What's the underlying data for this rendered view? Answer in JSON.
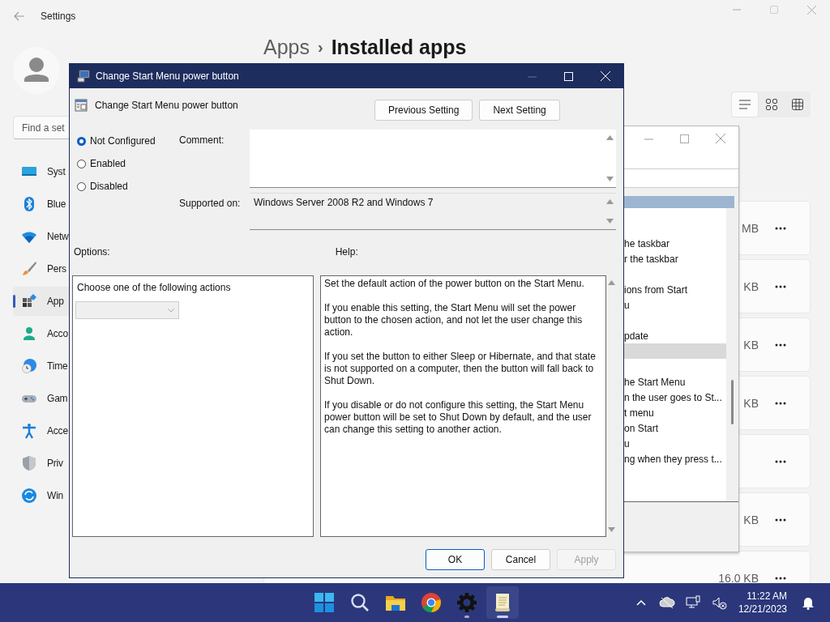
{
  "settings_window": {
    "title": "Settings",
    "search": {
      "placeholder": "Find a set"
    },
    "heading": {
      "parent": "Apps",
      "separator": "›",
      "current": "Installed apps"
    },
    "sidebar": {
      "items": [
        {
          "label": "Syst",
          "kind": "system",
          "selected": false
        },
        {
          "label": "Blue",
          "kind": "bluetooth",
          "selected": false
        },
        {
          "label": "Netw",
          "kind": "network",
          "selected": false
        },
        {
          "label": "Pers",
          "kind": "personalization",
          "selected": false
        },
        {
          "label": "App",
          "kind": "apps",
          "selected": true
        },
        {
          "label": "Acco",
          "kind": "accounts",
          "selected": false
        },
        {
          "label": "Time",
          "kind": "time",
          "selected": false
        },
        {
          "label": "Gam",
          "kind": "gaming",
          "selected": false
        },
        {
          "label": "Acce",
          "kind": "accessibility",
          "selected": false
        },
        {
          "label": "Priv",
          "kind": "privacy",
          "selected": false
        },
        {
          "label": "Win",
          "kind": "update",
          "selected": false
        }
      ]
    },
    "view_buttons": [
      {
        "kind": "list",
        "selected": true
      },
      {
        "kind": "tiles",
        "selected": false
      },
      {
        "kind": "grid",
        "selected": false
      }
    ],
    "app_rows": [
      {
        "size": "MB"
      },
      {
        "size": "KB"
      },
      {
        "size": "KB"
      },
      {
        "size": "KB"
      },
      {},
      {
        "size": "KB"
      },
      {
        "size": "16.0 KB"
      }
    ]
  },
  "policy_editor_window": {
    "rows": [
      {
        "text": "he taskbar",
        "selected": false
      },
      {
        "text": "r the taskbar",
        "selected": false
      },
      {
        "selected": false
      },
      {
        "text": "ions from Start",
        "selected": false
      },
      {
        "text": "u",
        "selected": false
      },
      {
        "selected": false
      },
      {
        "text": "pdate",
        "selected": false
      },
      {
        "selected": true
      },
      {
        "selected": false
      },
      {
        "text": "he Start Menu",
        "selected": false
      },
      {
        "text": "n the user goes to St...",
        "selected": false
      },
      {
        "text": "t menu",
        "selected": false
      },
      {
        "text": "on Start",
        "selected": false
      },
      {
        "text": "u",
        "selected": false
      },
      {
        "text": "ng when they press t...",
        "selected": false
      }
    ]
  },
  "dialog": {
    "title": "Change Start Menu power button",
    "setting_name": "Change Start Menu power button",
    "nav_buttons": [
      "Previous Setting",
      "Next Setting"
    ],
    "states": [
      {
        "label": "Not Configured",
        "selected": true
      },
      {
        "label": "Enabled",
        "selected": false
      },
      {
        "label": "Disabled",
        "selected": false
      }
    ],
    "comment_label": "Comment:",
    "supported_label": "Supported on:",
    "supported_value": "Windows Server 2008 R2 and Windows 7",
    "options_label": "Options:",
    "help_label": "Help:",
    "options": {
      "prompt": "Choose one of the following actions",
      "dropdown": {
        "disabled": true
      }
    },
    "help_paragraphs": [
      "Set the default action of the power button on the Start Menu.",
      "If you enable this setting, the Start Menu will set the power button to the chosen action, and not let the user change this action.",
      "If you set the button to either Sleep or Hibernate, and that state is not supported on a computer, then the button will fall back to Shut Down.",
      "If you disable or do not configure this setting, the Start Menu power button will be set to Shut Down by default, and the user can change this setting to another action."
    ],
    "buttons": [
      {
        "label": "OK",
        "kind": "default",
        "disabled": false
      },
      {
        "label": "Cancel",
        "kind": "normal",
        "disabled": false
      },
      {
        "label": "Apply",
        "kind": "normal",
        "disabled": true
      }
    ]
  },
  "taskbar": {
    "apps": [
      {
        "kind": "start",
        "running": false,
        "selected": false
      },
      {
        "kind": "search",
        "running": false,
        "selected": false
      },
      {
        "kind": "folder",
        "running": false,
        "selected": false
      },
      {
        "kind": "browser",
        "running": false,
        "selected": false
      },
      {
        "kind": "gear",
        "running": true,
        "selected": false
      },
      {
        "kind": "notepad",
        "running": true,
        "selected": true
      }
    ],
    "tray": [
      {
        "kind": "chevron"
      },
      {
        "kind": "cloud"
      },
      {
        "kind": "monitor"
      },
      {
        "kind": "speaker"
      }
    ],
    "clock": {
      "time": "11:22 AM",
      "date": "12/21/2023"
    }
  }
}
